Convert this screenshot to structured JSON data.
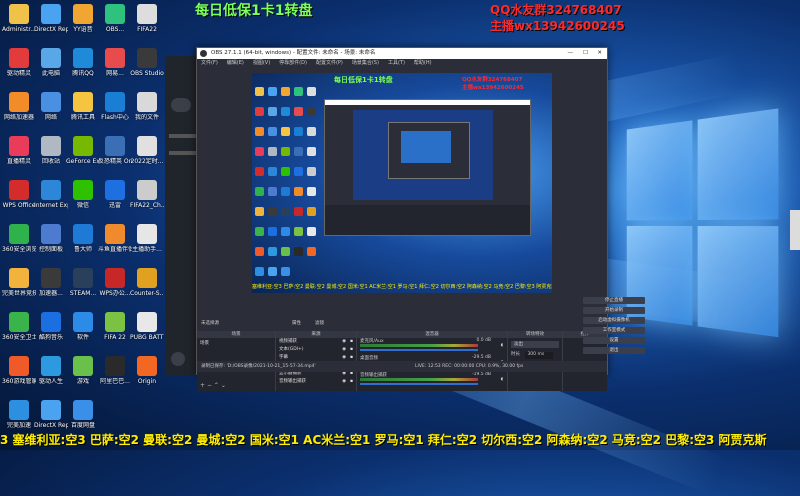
{
  "overlay": {
    "headline": "每日低保1卡1转盘",
    "qq_group": "QQ水友群324768407",
    "anchor_wechat": "主播wx13942600245"
  },
  "desktop_icons": [
    {
      "label": "Administr...",
      "color": "#f0c24a"
    },
    {
      "label": "DirectX Repair v4...",
      "color": "#4aa3f0"
    },
    {
      "label": "YY语音",
      "color": "#f0a630"
    },
    {
      "label": "OBS...",
      "color": "#2ec27e"
    },
    {
      "label": "FIFA22",
      "color": "#dddddd"
    },
    {
      "label": "驱动精灵",
      "color": "#e23b3b"
    },
    {
      "label": "此电脑",
      "color": "#59a7e6"
    },
    {
      "label": "腾讯QQ",
      "color": "#1f8ad8"
    },
    {
      "label": "网易...",
      "color": "#e84b4b"
    },
    {
      "label": "OBS Studio",
      "color": "#3a3a3a"
    },
    {
      "label": "网络加速器",
      "color": "#f28c28"
    },
    {
      "label": "网络",
      "color": "#4a90e2"
    },
    {
      "label": "腾讯工具",
      "color": "#f5c542"
    },
    {
      "label": "Flash中心",
      "color": "#1a7fd4"
    },
    {
      "label": "我的文件",
      "color": "#d9d9d9"
    },
    {
      "label": "直播精灵",
      "color": "#e83c5a"
    },
    {
      "label": "回收站",
      "color": "#b0b8c4"
    },
    {
      "label": "GeForce Experience",
      "color": "#76b900"
    },
    {
      "label": "反恐精英 Online",
      "color": "#3b6fb5"
    },
    {
      "label": "2022定时...",
      "color": "#e0e0e0"
    },
    {
      "label": "WPS Office",
      "color": "#d42b2b"
    },
    {
      "label": "Internet Explorer",
      "color": "#2d87d8"
    },
    {
      "label": "微信",
      "color": "#2dc100"
    },
    {
      "label": "迅雷",
      "color": "#1e6fe0"
    },
    {
      "label": "FIFA22_Ch... Tabloid...",
      "color": "#cccccc"
    },
    {
      "label": "360安全浏览器",
      "color": "#2fb24b"
    },
    {
      "label": "控制面板",
      "color": "#4d7bd0"
    },
    {
      "label": "鲁大师",
      "color": "#1f7ad6"
    },
    {
      "label": "斗鱼直播伴侣",
      "color": "#ef8a2d"
    },
    {
      "label": "主播助手...",
      "color": "#e6e6e6"
    },
    {
      "label": "完美世界竞技平台",
      "color": "#f2b33d"
    },
    {
      "label": "加速器...",
      "color": "#3a3a3a"
    },
    {
      "label": "STEAM...",
      "color": "#2a3f5a"
    },
    {
      "label": "WPS办公...",
      "color": "#c62828"
    },
    {
      "label": "Counter-S... Global Off...",
      "color": "#e0a020"
    },
    {
      "label": "360安全卫士",
      "color": "#39b34a"
    },
    {
      "label": "酷狗音乐",
      "color": "#1b6fe0"
    },
    {
      "label": "软件",
      "color": "#2b8be6"
    },
    {
      "label": "FIFA 22",
      "color": "#7cc242"
    },
    {
      "label": "PUBG BATTLEG...",
      "color": "#e8e8e8"
    },
    {
      "label": "360游戏管家",
      "color": "#f05a28"
    },
    {
      "label": "驱动人生",
      "color": "#2d9ae0"
    },
    {
      "label": "游戏",
      "color": "#6ac04a"
    },
    {
      "label": "阿里巴巴...",
      "color": "#2a2a2a"
    },
    {
      "label": "Origin",
      "color": "#f26722"
    },
    {
      "label": "完美加速",
      "color": "#2d8fe0"
    },
    {
      "label": "DirectX Repair v4...",
      "color": "#4aa3f0"
    },
    {
      "label": "百度网盘",
      "color": "#3a8fe8"
    }
  ],
  "obs": {
    "title": "OBS 27.1.1 (64-bit, windows) - 配置文件: 未命名 - 场景: 未命名",
    "menu": [
      "文件(F)",
      "编辑(E)",
      "视图(V)",
      "停靠部件(D)",
      "配置文件(P)",
      "场景集合(S)",
      "工具(T)",
      "帮助(H)"
    ],
    "preview_ticker": "塞维利亚:空3 巴萨:空2 曼联:空2 曼城:空2 国米:空1 AC米兰:空1 罗马:空1 拜仁:空2 切尔西:空2 阿森纳:空2 马竞:空2 巴黎:空3 阿贾克斯",
    "status_left": "未选择源",
    "props_btn": "属性",
    "filters_btn": "滤镜",
    "dock_headers": [
      "场景",
      "来源",
      "混音器",
      "转场特效",
      "控件"
    ],
    "scene_item": "场景",
    "sources": [
      "视频捕获",
      "文本(GDI+)",
      "字幕",
      "浏览器来源",
      "显示器捕获",
      "音频输出捕获"
    ],
    "mixer": [
      {
        "name": "麦克风/Aux",
        "db": "0.0 dB"
      },
      {
        "name": "桌面音频",
        "db": "-29.5 dB"
      },
      {
        "name": "音频输出捕获",
        "db": "-19.5 dB"
      }
    ],
    "transition": {
      "type": "淡出",
      "duration_label": "时长",
      "duration": "300 ms"
    },
    "controls": [
      "停止直播",
      "开始录制",
      "启动虚拟摄像机",
      "工作室模式",
      "设置",
      "退出"
    ],
    "statusbar": "录制已保存: 'D:/OBS录像/2021-10-21_15-57-34.mp4'",
    "stats": "LIVE: 12:53  REC: 00:00:00  CPU: 0.9%, 30.00 fps"
  },
  "ticker": "3 塞维利亚:空3 巴萨:空2 曼联:空2 曼城:空2 国米:空1 AC米兰:空1 罗马:空1 拜仁:空2 切尔西:空2 阿森纳:空2 马竞:空2 巴黎:空3 阿贾克斯"
}
